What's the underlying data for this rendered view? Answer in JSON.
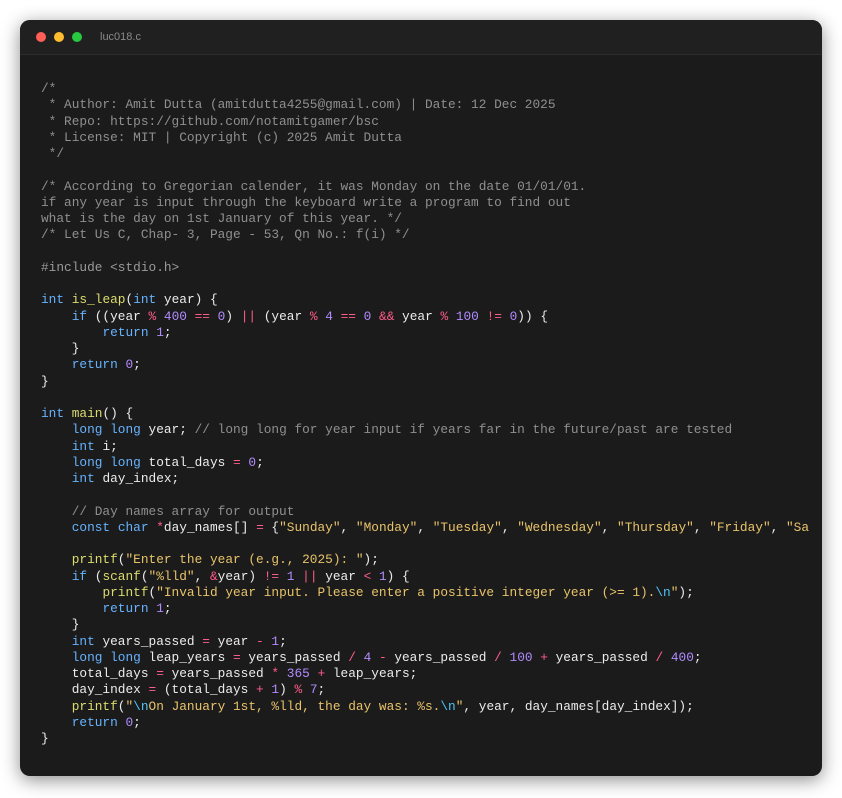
{
  "window": {
    "title": "luc018.c",
    "colors": {
      "background": "#1b1b1b",
      "titlebar": "#202020",
      "close": "#ff5f57",
      "minimize": "#febc2e",
      "maximize": "#28c840"
    }
  },
  "code": {
    "language": "c",
    "token_colors": {
      "comment": "#8f8f8f",
      "keyword": "#66b3ff",
      "func": "#dcdc6e",
      "string": "#e8c36a",
      "number": "#b18cff",
      "operator": "#ff5c8a",
      "preproc": "#9a9a9a",
      "escape": "#4fc3f7",
      "plain": "#ececec"
    },
    "lines": [
      [
        [
          "comment",
          "/*"
        ]
      ],
      [
        [
          "comment",
          " * Author: Amit Dutta (amitdutta4255@gmail.com) | Date: 12 Dec 2025"
        ]
      ],
      [
        [
          "comment",
          " * Repo: https://github.com/notamitgamer/bsc"
        ]
      ],
      [
        [
          "comment",
          " * License: MIT | Copyright (c) 2025 Amit Dutta"
        ]
      ],
      [
        [
          "comment",
          " */"
        ]
      ],
      [],
      [
        [
          "comment",
          "/* According to Gregorian calender, it was Monday on the date 01/01/01."
        ]
      ],
      [
        [
          "comment",
          "if any year is input through the keyboard write a program to find out"
        ]
      ],
      [
        [
          "comment",
          "what is the day on 1st January of this year. */"
        ]
      ],
      [
        [
          "comment",
          "/* Let Us C, Chap- 3, Page - 53, Qn No.: f(i) */"
        ]
      ],
      [],
      [
        [
          "preproc",
          "#include <stdio.h>"
        ]
      ],
      [],
      [
        [
          "keyword",
          "int"
        ],
        [
          "plain",
          " "
        ],
        [
          "func",
          "is_leap"
        ],
        [
          "plain",
          "("
        ],
        [
          "keyword",
          "int"
        ],
        [
          "plain",
          " year) {"
        ]
      ],
      [
        [
          "plain",
          "    "
        ],
        [
          "keyword",
          "if"
        ],
        [
          "plain",
          " ((year "
        ],
        [
          "operator",
          "%"
        ],
        [
          "plain",
          " "
        ],
        [
          "number",
          "400"
        ],
        [
          "plain",
          " "
        ],
        [
          "operator",
          "=="
        ],
        [
          "plain",
          " "
        ],
        [
          "number",
          "0"
        ],
        [
          "plain",
          ") "
        ],
        [
          "operator",
          "||"
        ],
        [
          "plain",
          " (year "
        ],
        [
          "operator",
          "%"
        ],
        [
          "plain",
          " "
        ],
        [
          "number",
          "4"
        ],
        [
          "plain",
          " "
        ],
        [
          "operator",
          "=="
        ],
        [
          "plain",
          " "
        ],
        [
          "number",
          "0"
        ],
        [
          "plain",
          " "
        ],
        [
          "operator",
          "&&"
        ],
        [
          "plain",
          " year "
        ],
        [
          "operator",
          "%"
        ],
        [
          "plain",
          " "
        ],
        [
          "number",
          "100"
        ],
        [
          "plain",
          " "
        ],
        [
          "operator",
          "!="
        ],
        [
          "plain",
          " "
        ],
        [
          "number",
          "0"
        ],
        [
          "plain",
          ")) {"
        ]
      ],
      [
        [
          "plain",
          "        "
        ],
        [
          "keyword",
          "return"
        ],
        [
          "plain",
          " "
        ],
        [
          "number",
          "1"
        ],
        [
          "plain",
          ";"
        ]
      ],
      [
        [
          "plain",
          "    }"
        ]
      ],
      [
        [
          "plain",
          "    "
        ],
        [
          "keyword",
          "return"
        ],
        [
          "plain",
          " "
        ],
        [
          "number",
          "0"
        ],
        [
          "plain",
          ";"
        ]
      ],
      [
        [
          "plain",
          "}"
        ]
      ],
      [],
      [
        [
          "keyword",
          "int"
        ],
        [
          "plain",
          " "
        ],
        [
          "func",
          "main"
        ],
        [
          "plain",
          "() {"
        ]
      ],
      [
        [
          "plain",
          "    "
        ],
        [
          "keyword",
          "long"
        ],
        [
          "plain",
          " "
        ],
        [
          "keyword",
          "long"
        ],
        [
          "plain",
          " year; "
        ],
        [
          "comment",
          "// long long for year input if years far in the future/past are tested"
        ]
      ],
      [
        [
          "plain",
          "    "
        ],
        [
          "keyword",
          "int"
        ],
        [
          "plain",
          " i;"
        ]
      ],
      [
        [
          "plain",
          "    "
        ],
        [
          "keyword",
          "long"
        ],
        [
          "plain",
          " "
        ],
        [
          "keyword",
          "long"
        ],
        [
          "plain",
          " total_days "
        ],
        [
          "operator",
          "="
        ],
        [
          "plain",
          " "
        ],
        [
          "number",
          "0"
        ],
        [
          "plain",
          ";"
        ]
      ],
      [
        [
          "plain",
          "    "
        ],
        [
          "keyword",
          "int"
        ],
        [
          "plain",
          " day_index;"
        ]
      ],
      [],
      [
        [
          "plain",
          "    "
        ],
        [
          "comment",
          "// Day names array for output"
        ]
      ],
      [
        [
          "plain",
          "    "
        ],
        [
          "keyword",
          "const"
        ],
        [
          "plain",
          " "
        ],
        [
          "keyword",
          "char"
        ],
        [
          "plain",
          " "
        ],
        [
          "operator",
          "*"
        ],
        [
          "plain",
          "day_names[] "
        ],
        [
          "operator",
          "="
        ],
        [
          "plain",
          " {"
        ],
        [
          "string",
          "\"Sunday\""
        ],
        [
          "plain",
          ", "
        ],
        [
          "string",
          "\"Monday\""
        ],
        [
          "plain",
          ", "
        ],
        [
          "string",
          "\"Tuesday\""
        ],
        [
          "plain",
          ", "
        ],
        [
          "string",
          "\"Wednesday\""
        ],
        [
          "plain",
          ", "
        ],
        [
          "string",
          "\"Thursday\""
        ],
        [
          "plain",
          ", "
        ],
        [
          "string",
          "\"Friday\""
        ],
        [
          "plain",
          ", "
        ],
        [
          "string",
          "\"Sa"
        ]
      ],
      [],
      [
        [
          "plain",
          "    "
        ],
        [
          "func",
          "printf"
        ],
        [
          "plain",
          "("
        ],
        [
          "string",
          "\"Enter the year (e.g., 2025): \""
        ],
        [
          "plain",
          ");"
        ]
      ],
      [
        [
          "plain",
          "    "
        ],
        [
          "keyword",
          "if"
        ],
        [
          "plain",
          " ("
        ],
        [
          "func",
          "scanf"
        ],
        [
          "plain",
          "("
        ],
        [
          "string",
          "\"%lld\""
        ],
        [
          "plain",
          ", "
        ],
        [
          "operator",
          "&"
        ],
        [
          "plain",
          "year) "
        ],
        [
          "operator",
          "!="
        ],
        [
          "plain",
          " "
        ],
        [
          "number",
          "1"
        ],
        [
          "plain",
          " "
        ],
        [
          "operator",
          "||"
        ],
        [
          "plain",
          " year "
        ],
        [
          "operator",
          "<"
        ],
        [
          "plain",
          " "
        ],
        [
          "number",
          "1"
        ],
        [
          "plain",
          ") {"
        ]
      ],
      [
        [
          "plain",
          "        "
        ],
        [
          "func",
          "printf"
        ],
        [
          "plain",
          "("
        ],
        [
          "string",
          "\"Invalid year input. Please enter a positive integer year (>= 1)."
        ],
        [
          "escape",
          "\\n"
        ],
        [
          "string",
          "\""
        ],
        [
          "plain",
          ");"
        ]
      ],
      [
        [
          "plain",
          "        "
        ],
        [
          "keyword",
          "return"
        ],
        [
          "plain",
          " "
        ],
        [
          "number",
          "1"
        ],
        [
          "plain",
          ";"
        ]
      ],
      [
        [
          "plain",
          "    }"
        ]
      ],
      [
        [
          "plain",
          "    "
        ],
        [
          "keyword",
          "int"
        ],
        [
          "plain",
          " years_passed "
        ],
        [
          "operator",
          "="
        ],
        [
          "plain",
          " year "
        ],
        [
          "operator",
          "-"
        ],
        [
          "plain",
          " "
        ],
        [
          "number",
          "1"
        ],
        [
          "plain",
          ";"
        ]
      ],
      [
        [
          "plain",
          "    "
        ],
        [
          "keyword",
          "long"
        ],
        [
          "plain",
          " "
        ],
        [
          "keyword",
          "long"
        ],
        [
          "plain",
          " leap_years "
        ],
        [
          "operator",
          "="
        ],
        [
          "plain",
          " years_passed "
        ],
        [
          "operator",
          "/"
        ],
        [
          "plain",
          " "
        ],
        [
          "number",
          "4"
        ],
        [
          "plain",
          " "
        ],
        [
          "operator",
          "-"
        ],
        [
          "plain",
          " years_passed "
        ],
        [
          "operator",
          "/"
        ],
        [
          "plain",
          " "
        ],
        [
          "number",
          "100"
        ],
        [
          "plain",
          " "
        ],
        [
          "operator",
          "+"
        ],
        [
          "plain",
          " years_passed "
        ],
        [
          "operator",
          "/"
        ],
        [
          "plain",
          " "
        ],
        [
          "number",
          "400"
        ],
        [
          "plain",
          ";"
        ]
      ],
      [
        [
          "plain",
          "    total_days "
        ],
        [
          "operator",
          "="
        ],
        [
          "plain",
          " years_passed "
        ],
        [
          "operator",
          "*"
        ],
        [
          "plain",
          " "
        ],
        [
          "number",
          "365"
        ],
        [
          "plain",
          " "
        ],
        [
          "operator",
          "+"
        ],
        [
          "plain",
          " leap_years;"
        ]
      ],
      [
        [
          "plain",
          "    day_index "
        ],
        [
          "operator",
          "="
        ],
        [
          "plain",
          " (total_days "
        ],
        [
          "operator",
          "+"
        ],
        [
          "plain",
          " "
        ],
        [
          "number",
          "1"
        ],
        [
          "plain",
          ") "
        ],
        [
          "operator",
          "%"
        ],
        [
          "plain",
          " "
        ],
        [
          "number",
          "7"
        ],
        [
          "plain",
          ";"
        ]
      ],
      [
        [
          "plain",
          "    "
        ],
        [
          "func",
          "printf"
        ],
        [
          "plain",
          "("
        ],
        [
          "string",
          "\""
        ],
        [
          "escape",
          "\\n"
        ],
        [
          "string",
          "On January 1st, %lld, the day was: %s."
        ],
        [
          "escape",
          "\\n"
        ],
        [
          "string",
          "\""
        ],
        [
          "plain",
          ", year, day_names[day_index]);"
        ]
      ],
      [
        [
          "plain",
          "    "
        ],
        [
          "keyword",
          "return"
        ],
        [
          "plain",
          " "
        ],
        [
          "number",
          "0"
        ],
        [
          "plain",
          ";"
        ]
      ],
      [
        [
          "plain",
          "}"
        ]
      ]
    ]
  }
}
